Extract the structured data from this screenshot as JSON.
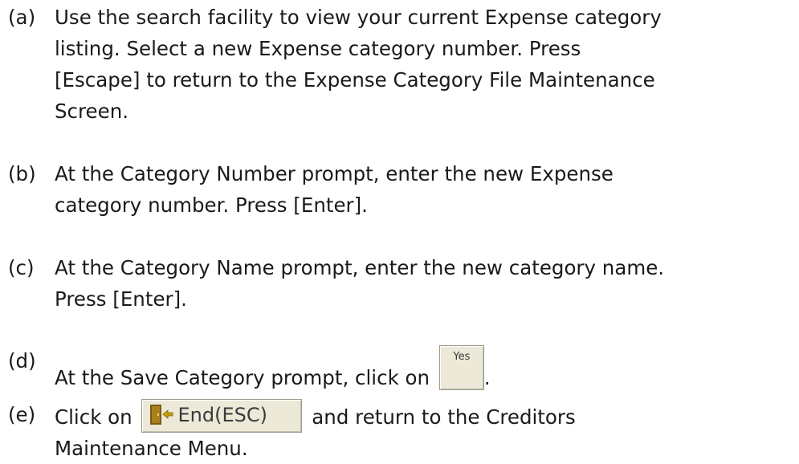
{
  "steps": {
    "a": {
      "marker": "(a)",
      "lines": [
        "Use the search facility to view your current Expense category",
        "listing. Select a new Expense category number. Press",
        "[Escape] to return to the Expense Category File Maintenance",
        "Screen."
      ]
    },
    "b": {
      "marker": "(b)",
      "lines": [
        "At the Category Number prompt, enter the new Expense",
        "category number. Press [Enter]."
      ]
    },
    "c": {
      "marker": "(c)",
      "lines": [
        "At the Category Name prompt, enter the new category name.",
        "Press [Enter]."
      ]
    },
    "d": {
      "marker": "(d)",
      "text_before": "At the Save Category prompt, click on ",
      "button_label": "Yes",
      "text_after": "."
    },
    "e": {
      "marker": "(e)",
      "text_before": "Click on ",
      "button_label": "End(ESC)",
      "button_icon": "exit-door-icon",
      "text_after": " and return to the Creditors",
      "line2": "Maintenance Menu."
    }
  },
  "colors": {
    "text": "#1a1a1a",
    "button_face": "#ece9d8",
    "button_border": "#9c9a8c",
    "icon_door": "#7a5a12",
    "icon_arrow": "#c9a200"
  }
}
